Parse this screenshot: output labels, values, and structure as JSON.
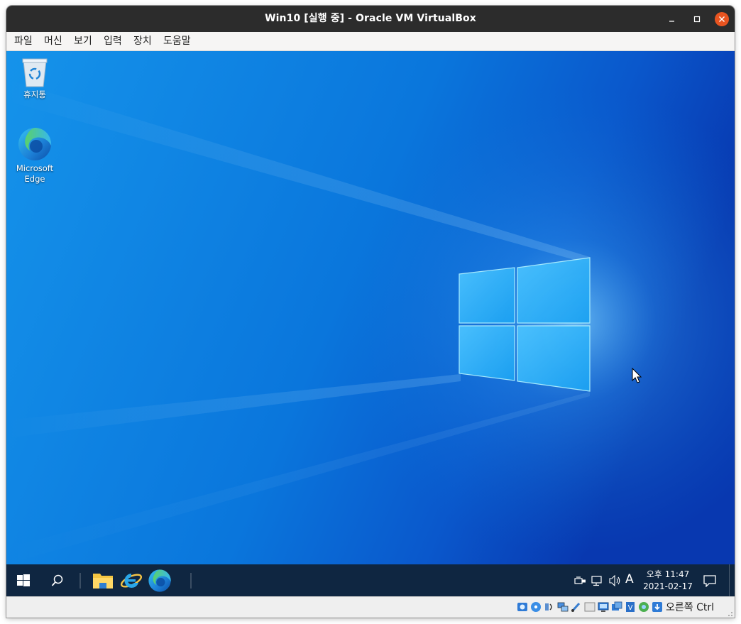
{
  "window": {
    "title": "Win10 [실행 중] - Oracle VM VirtualBox",
    "controls": [
      "minimize",
      "maximize",
      "close"
    ]
  },
  "menubar": {
    "items": [
      "파일",
      "머신",
      "보기",
      "입력",
      "장치",
      "도움말"
    ]
  },
  "desktop": {
    "icons": [
      {
        "label": "휴지통",
        "icon": "recycle-bin-icon"
      },
      {
        "label": "Microsoft Edge",
        "icon": "edge-icon"
      }
    ]
  },
  "taskbar": {
    "start_icon": "windows-start-icon",
    "search_icon": "search-icon",
    "pinned": [
      "file-explorer-icon",
      "internet-explorer-icon",
      "edge-icon"
    ],
    "tray": {
      "icons": [
        "usb-device-icon",
        "network-icon",
        "volume-icon"
      ],
      "ime_label": "A",
      "time": "오후 11:47",
      "date": "2021-02-17",
      "notification_icon": "notification-icon"
    }
  },
  "statusbar": {
    "icons": [
      "hard-disk-icon",
      "optical-drive-icon",
      "audio-icon",
      "network-adapter-icon",
      "usb-icon",
      "shared-folders-icon",
      "display-icon",
      "video-capture-icon",
      "cpu-icon",
      "vt-x-icon",
      "guest-additions-icon",
      "mouse-integration-icon"
    ],
    "host_key": "오른쪽 Ctrl"
  },
  "colors": {
    "titlebar": "#2c2c2c",
    "close_button": "#e95420",
    "taskbar": "#0f2641",
    "wallpaper_primary": "#0a78d7",
    "wallpaper_dark": "#0a3db8"
  }
}
